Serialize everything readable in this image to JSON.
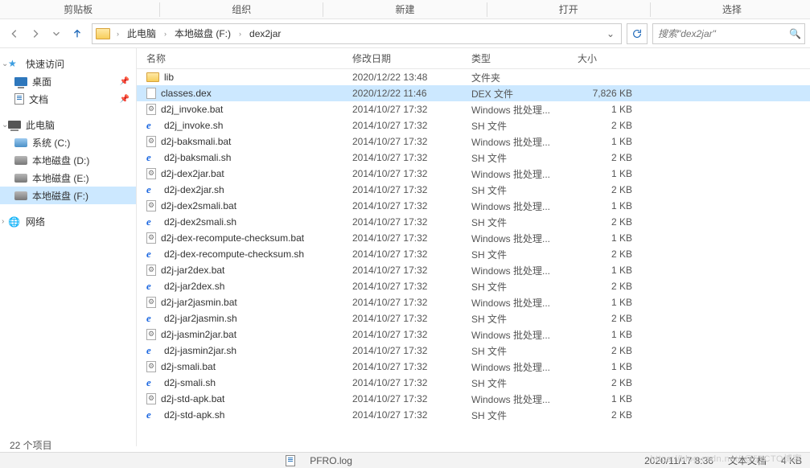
{
  "toolbar_groups": [
    "剪贴板",
    "组织",
    "新建",
    "打开",
    "选择"
  ],
  "breadcrumbs": [
    "此电脑",
    "本地磁盘 (F:)",
    "dex2jar"
  ],
  "search_placeholder": "搜索\"dex2jar\"",
  "sidebar": {
    "quick": {
      "label": "快速访问",
      "items": [
        {
          "label": "桌面",
          "icon": "ic-desktop",
          "pinned": true
        },
        {
          "label": "文档",
          "icon": "ic-doc",
          "pinned": true
        }
      ]
    },
    "pc": {
      "label": "此电脑",
      "items": [
        {
          "label": "系统 (C:)",
          "icon": "ic-disk sys"
        },
        {
          "label": "本地磁盘 (D:)",
          "icon": "ic-disk"
        },
        {
          "label": "本地磁盘 (E:)",
          "icon": "ic-disk"
        },
        {
          "label": "本地磁盘 (F:)",
          "icon": "ic-disk",
          "selected": true
        }
      ]
    },
    "network": {
      "label": "网络"
    }
  },
  "columns": {
    "name": "名称",
    "date": "修改日期",
    "type": "类型",
    "size": "大小"
  },
  "files": [
    {
      "name": "lib",
      "date": "2020/12/22 13:48",
      "type": "文件夹",
      "size": "",
      "icon": "ic-folder"
    },
    {
      "name": "classes.dex",
      "date": "2020/12/22 11:46",
      "type": "DEX 文件",
      "size": "7,826 KB",
      "icon": "ic-file",
      "selected": true
    },
    {
      "name": "d2j_invoke.bat",
      "date": "2014/10/27 17:32",
      "type": "Windows 批处理...",
      "size": "1 KB",
      "icon": "ic-bat"
    },
    {
      "name": "d2j_invoke.sh",
      "date": "2014/10/27 17:32",
      "type": "SH 文件",
      "size": "2 KB",
      "icon": "ic-ie"
    },
    {
      "name": "d2j-baksmali.bat",
      "date": "2014/10/27 17:32",
      "type": "Windows 批处理...",
      "size": "1 KB",
      "icon": "ic-bat"
    },
    {
      "name": "d2j-baksmali.sh",
      "date": "2014/10/27 17:32",
      "type": "SH 文件",
      "size": "2 KB",
      "icon": "ic-ie"
    },
    {
      "name": "d2j-dex2jar.bat",
      "date": "2014/10/27 17:32",
      "type": "Windows 批处理...",
      "size": "1 KB",
      "icon": "ic-bat"
    },
    {
      "name": "d2j-dex2jar.sh",
      "date": "2014/10/27 17:32",
      "type": "SH 文件",
      "size": "2 KB",
      "icon": "ic-ie"
    },
    {
      "name": "d2j-dex2smali.bat",
      "date": "2014/10/27 17:32",
      "type": "Windows 批处理...",
      "size": "1 KB",
      "icon": "ic-bat"
    },
    {
      "name": "d2j-dex2smali.sh",
      "date": "2014/10/27 17:32",
      "type": "SH 文件",
      "size": "2 KB",
      "icon": "ic-ie"
    },
    {
      "name": "d2j-dex-recompute-checksum.bat",
      "date": "2014/10/27 17:32",
      "type": "Windows 批处理...",
      "size": "1 KB",
      "icon": "ic-bat"
    },
    {
      "name": "d2j-dex-recompute-checksum.sh",
      "date": "2014/10/27 17:32",
      "type": "SH 文件",
      "size": "2 KB",
      "icon": "ic-ie"
    },
    {
      "name": "d2j-jar2dex.bat",
      "date": "2014/10/27 17:32",
      "type": "Windows 批处理...",
      "size": "1 KB",
      "icon": "ic-bat"
    },
    {
      "name": "d2j-jar2dex.sh",
      "date": "2014/10/27 17:32",
      "type": "SH 文件",
      "size": "2 KB",
      "icon": "ic-ie"
    },
    {
      "name": "d2j-jar2jasmin.bat",
      "date": "2014/10/27 17:32",
      "type": "Windows 批处理...",
      "size": "1 KB",
      "icon": "ic-bat"
    },
    {
      "name": "d2j-jar2jasmin.sh",
      "date": "2014/10/27 17:32",
      "type": "SH 文件",
      "size": "2 KB",
      "icon": "ic-ie"
    },
    {
      "name": "d2j-jasmin2jar.bat",
      "date": "2014/10/27 17:32",
      "type": "Windows 批处理...",
      "size": "1 KB",
      "icon": "ic-bat"
    },
    {
      "name": "d2j-jasmin2jar.sh",
      "date": "2014/10/27 17:32",
      "type": "SH 文件",
      "size": "2 KB",
      "icon": "ic-ie"
    },
    {
      "name": "d2j-smali.bat",
      "date": "2014/10/27 17:32",
      "type": "Windows 批处理...",
      "size": "1 KB",
      "icon": "ic-bat"
    },
    {
      "name": "d2j-smali.sh",
      "date": "2014/10/27 17:32",
      "type": "SH 文件",
      "size": "2 KB",
      "icon": "ic-ie"
    },
    {
      "name": "d2j-std-apk.bat",
      "date": "2014/10/27 17:32",
      "type": "Windows 批处理...",
      "size": "1 KB",
      "icon": "ic-bat"
    },
    {
      "name": "d2j-std-apk.sh",
      "date": "2014/10/27 17:32",
      "type": "SH 文件",
      "size": "2 KB",
      "icon": "ic-ie"
    }
  ],
  "status_text": "22 个项目",
  "bottom": {
    "file": "PFRO.log",
    "date": "2020/11/17 8:36",
    "type": "文本文档",
    "size": "4 KB"
  },
  "watermark": "https://blog.csdn.net/ @51CTO博客"
}
